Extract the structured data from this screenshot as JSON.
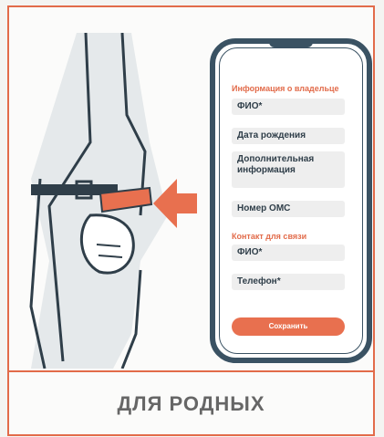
{
  "form": {
    "owner_section_title": "Информация о владельце",
    "fields": {
      "full_name": "ФИО*",
      "birth_date": "Дата рождения",
      "additional_info": "Дополнительная информация",
      "oms_number": "Номер ОМС"
    },
    "contact_section_title": "Контакт для связи",
    "contact_fields": {
      "full_name": "ФИО*",
      "phone": "Телефон*"
    },
    "save_label": "Сохранить"
  },
  "caption": "ДЛЯ РОДНЫХ",
  "colors": {
    "accent": "#e26b4a",
    "phone_frame": "#3a5263",
    "text": "#2f3e49"
  }
}
